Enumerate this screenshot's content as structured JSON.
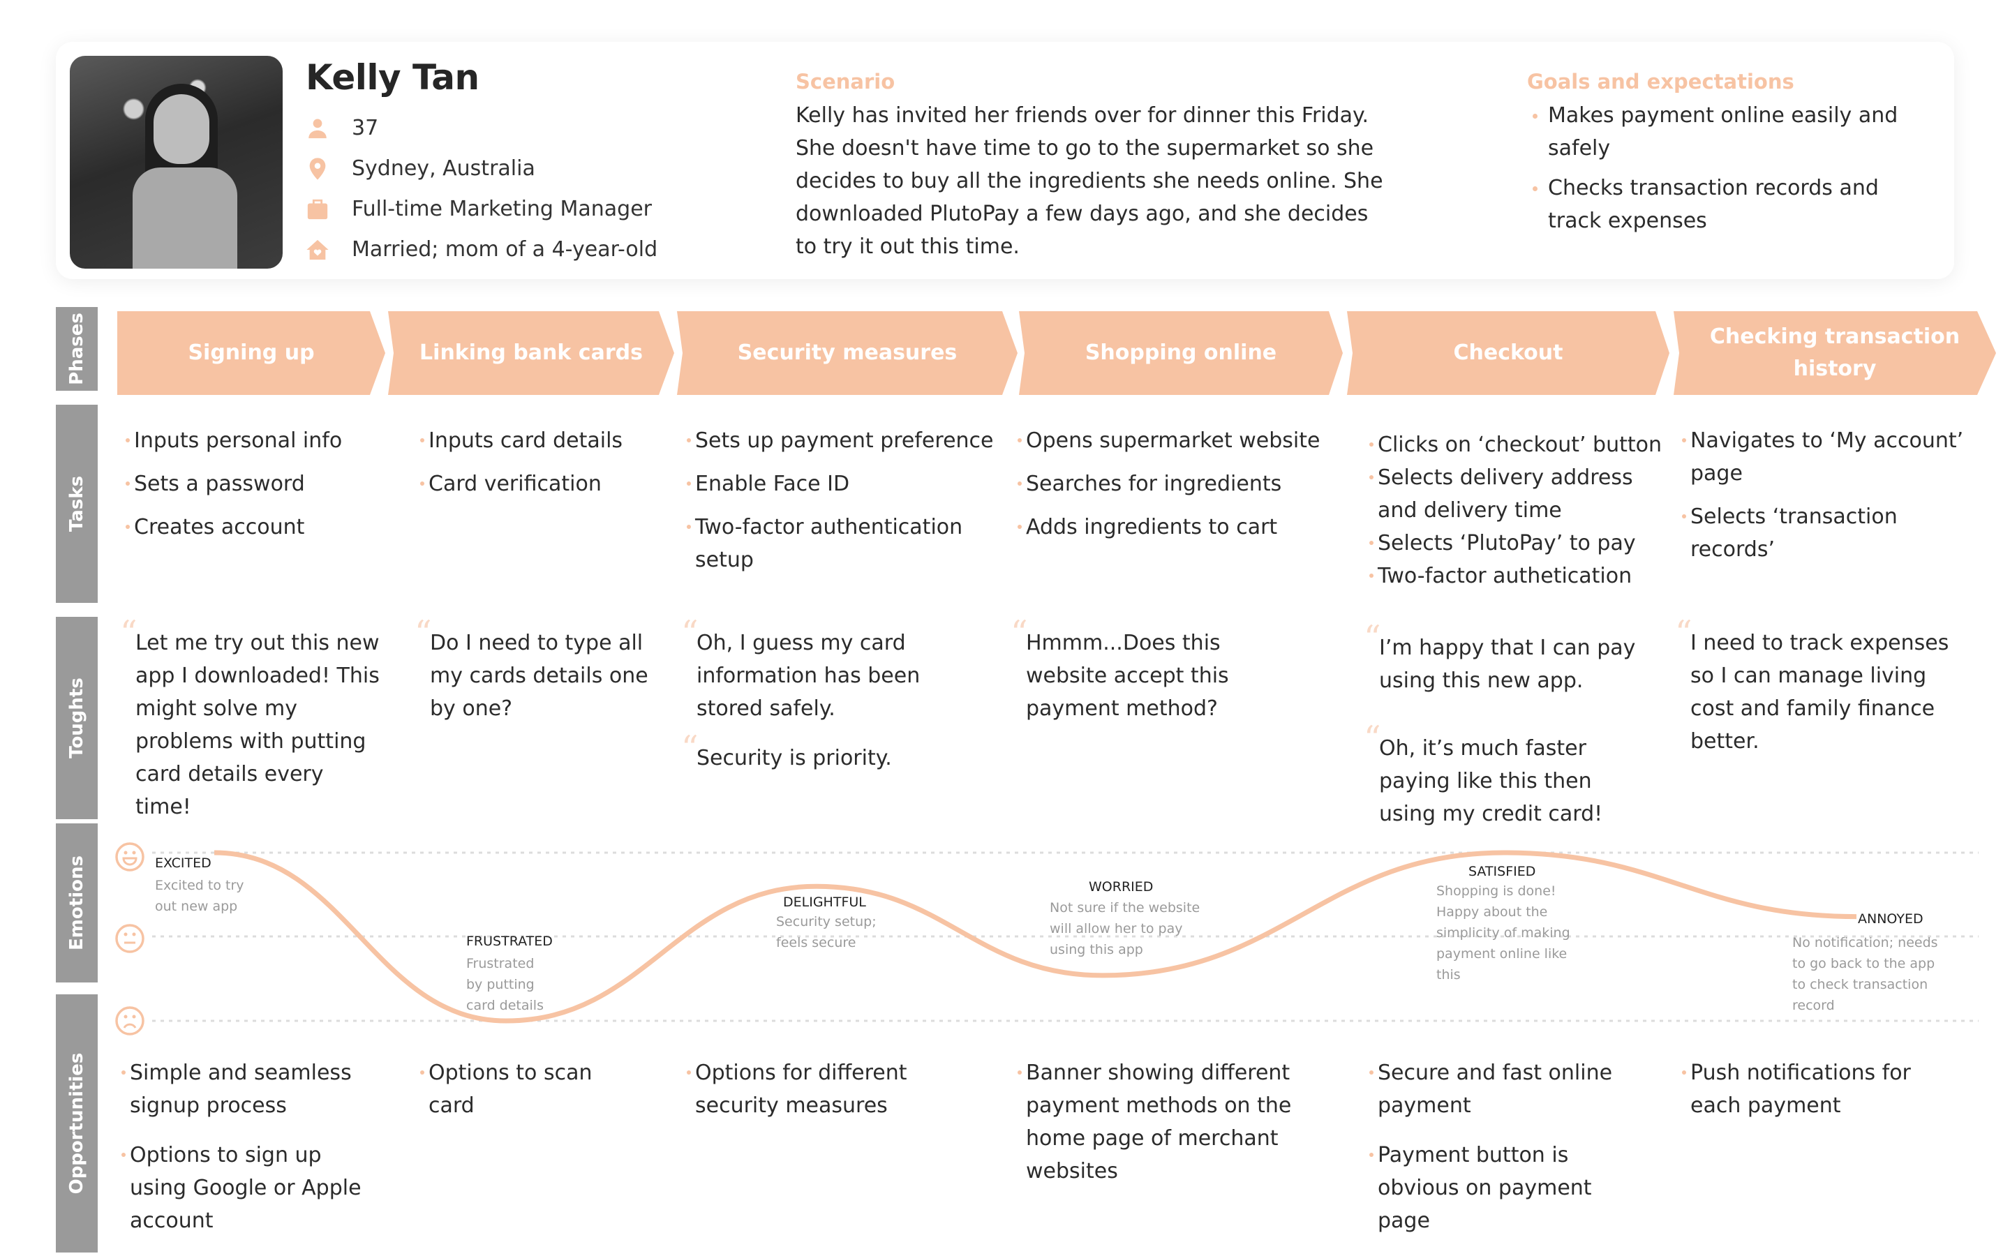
{
  "persona": {
    "name": "Kelly Tan",
    "photo_alt": "Portrait of Kelly Tan holding shopping bags",
    "details": [
      {
        "icon": "person-icon",
        "text": "37"
      },
      {
        "icon": "location-pin-icon",
        "text": "Sydney, Australia"
      },
      {
        "icon": "briefcase-icon",
        "text": "Full-time Marketing Manager"
      },
      {
        "icon": "home-heart-icon",
        "text": "Married; mom of a 4-year-old"
      }
    ]
  },
  "scenario": {
    "title": "Scenario",
    "lines": [
      "Kelly has invited her friends over for dinner this Friday.",
      "She doesn't have time to go to the supermarket so she",
      "decides to buy all the ingredients she needs online. She",
      "downloaded PlutoPay a few days ago, and she decides",
      "to try it out this time."
    ]
  },
  "goals": {
    "title": "Goals and expectations",
    "items": [
      "Makes payment online easily and safely",
      "Checks transaction records and track expenses"
    ]
  },
  "row_labels": {
    "phases": "Phases",
    "tasks": "Tasks",
    "thoughts": "Toughts",
    "emotions": "Emotions",
    "opportunities": "Opportunities"
  },
  "phases": [
    "Signing up",
    "Linking bank cards",
    "Security measures",
    "Shopping online",
    "Checkout",
    "Checking transaction history"
  ],
  "tasks": [
    [
      "Inputs personal info",
      "Sets a password",
      "Creates account"
    ],
    [
      "Inputs card details",
      "Card verification"
    ],
    [
      "Sets up payment preference",
      "Enable Face ID",
      "Two-factor authentication setup"
    ],
    [
      "Opens supermarket website",
      "Searches for ingredients",
      "Adds ingredients to cart"
    ],
    [
      "Clicks on ‘checkout’ button",
      "Selects delivery address and delivery time",
      "Selects ‘PlutoPay’ to pay",
      "Two-factor authetication"
    ],
    [
      "Navigates to ‘My account’ page",
      "Selects ‘transaction records’"
    ]
  ],
  "thoughts": [
    [
      "Let me try out this new app I downloaded! This might solve my problems with putting card details every time!"
    ],
    [
      "Do I need to type all my cards details one by one?"
    ],
    [
      "Oh, I guess my card information has been stored safely.",
      "Security is priority."
    ],
    [
      "Hmmm...Does this website accept this payment method?"
    ],
    [
      "I’m happy that I can pay using this new app.",
      "Oh, it’s much faster paying like this then using my credit card!"
    ],
    [
      "I need to track expenses so I can manage living cost and family finance better."
    ]
  ],
  "emotions": {
    "scale": [
      "happy",
      "neutral",
      "sad"
    ],
    "scale_icons": [
      "happy-face-icon",
      "neutral-face-icon",
      "sad-face-icon"
    ],
    "points": [
      {
        "label": "EXCITED",
        "desc": [
          "Excited to try",
          "out new app"
        ],
        "level": 1.0
      },
      {
        "label": "FRUSTRATED",
        "desc": [
          "Frustrated",
          "by putting",
          "card details"
        ],
        "level": 0.0
      },
      {
        "label": "DELIGHTFUL",
        "desc": [
          "Security setup;",
          "feels secure"
        ],
        "level": 0.8
      },
      {
        "label": "WORRIED",
        "desc": [
          "Not sure if the website",
          "will allow her to pay",
          "using this app"
        ],
        "level": 0.27
      },
      {
        "label": "SATISFIED",
        "desc": [
          "Shopping is done!",
          "Happy about the",
          "simplicity of making",
          "payment online like",
          "this"
        ],
        "level": 1.0
      },
      {
        "label": "ANNOYED",
        "desc": [
          "No notification; needs",
          "to go back to the app",
          "to check transaction",
          "record"
        ],
        "level": 0.62
      }
    ]
  },
  "opportunities": [
    [
      "Simple and seamless signup process",
      "Options to sign up using Google or Apple account"
    ],
    [
      "Options to scan card"
    ],
    [
      "Options for different security measures"
    ],
    [
      "Banner showing different payment methods on the home page of merchant websites"
    ],
    [
      "Secure and fast online payment",
      "Payment button is obvious on payment page"
    ],
    [
      "Push notifications for each payment"
    ]
  ],
  "colors": {
    "accent": "#f7c3a3",
    "row_label_bg": "#9a9a9a",
    "text": "#2b2b2b",
    "muted": "#9a9a9a"
  }
}
